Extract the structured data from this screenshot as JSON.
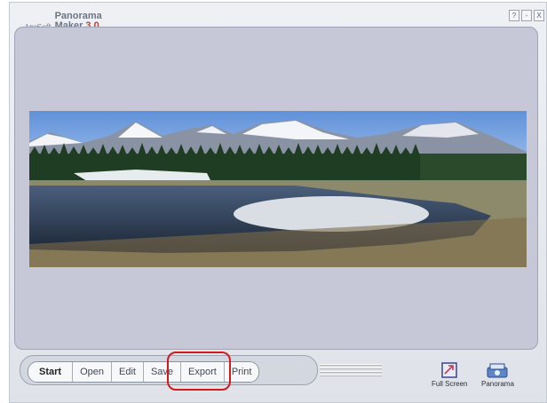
{
  "app": {
    "vendor": "ArcSoft",
    "name_line1": "Panorama",
    "name_line2": "Maker",
    "version": "3.0"
  },
  "window_controls": [
    "?",
    "-",
    "X"
  ],
  "toolbar": {
    "buttons": [
      {
        "label": "Start",
        "primary": true
      },
      {
        "label": "Open"
      },
      {
        "label": "Edit"
      },
      {
        "label": "Save",
        "highlighted": true
      },
      {
        "label": "Export"
      },
      {
        "label": "Print"
      }
    ]
  },
  "right_buttons": {
    "fullscreen_label": "Full Screen",
    "panorama_label": "Panorama"
  },
  "colors": {
    "highlight": "#d21a1a",
    "canvas": "#c6c8d8"
  }
}
